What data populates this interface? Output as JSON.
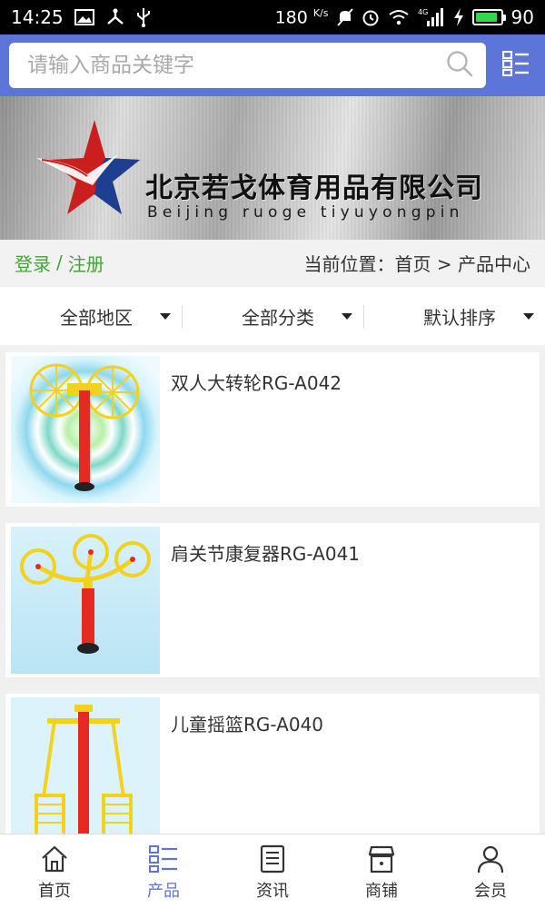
{
  "status_bar": {
    "time": "14:25",
    "network_speed": "180",
    "speed_unit": "K/s",
    "network_type": "4G",
    "battery_level": "90",
    "battery_fraction": 0.9
  },
  "search": {
    "placeholder": "请输入商品关键字"
  },
  "banner": {
    "company_name": "北京若戈体育用品有限公司",
    "company_pinyin": "Beijing ruoge tiyuyongpin"
  },
  "breadcrumb": {
    "login": "登录",
    "separator": "/",
    "register": "注册",
    "location": "当前位置：首页 > 产品中心"
  },
  "filters": [
    {
      "label": "全部地区"
    },
    {
      "label": "全部分类"
    },
    {
      "label": "默认排序"
    }
  ],
  "products": [
    {
      "name": "双人大转轮RG-A042"
    },
    {
      "name": "肩关节康复器RG-A041"
    },
    {
      "name": "儿童摇篮RG-A040"
    }
  ],
  "bottom_nav": [
    {
      "label": "首页",
      "icon": "home-icon",
      "active": false
    },
    {
      "label": "产品",
      "icon": "list-icon",
      "active": true
    },
    {
      "label": "资讯",
      "icon": "news-icon",
      "active": false
    },
    {
      "label": "商铺",
      "icon": "shop-icon",
      "active": false
    },
    {
      "label": "会员",
      "icon": "user-icon",
      "active": false
    }
  ],
  "colors": {
    "header_blue": "#5d74d8",
    "login_green": "#41a535",
    "active_nav": "#5d74d8"
  }
}
